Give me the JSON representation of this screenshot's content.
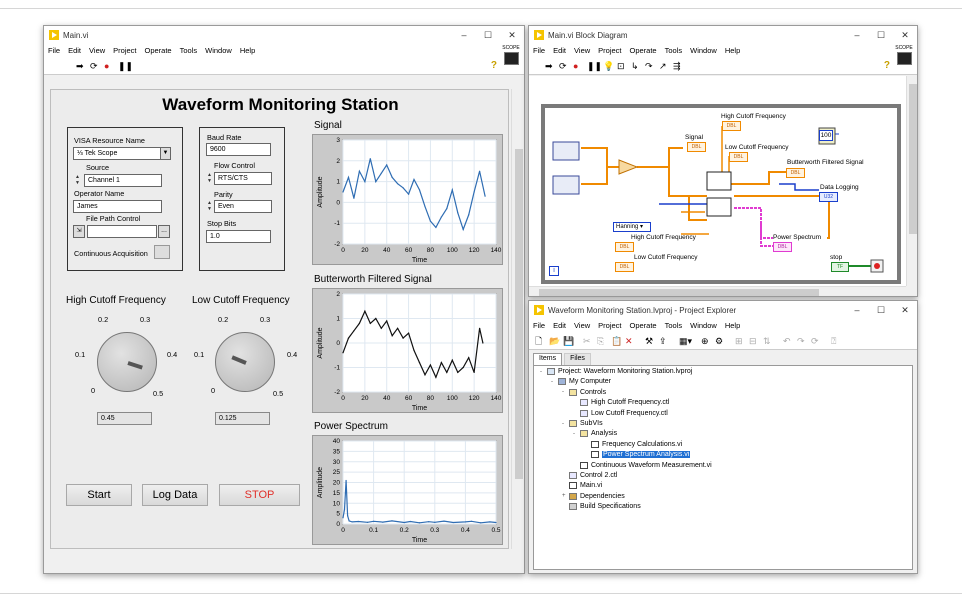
{
  "main_window": {
    "title": "Main.vi",
    "menu": [
      "File",
      "Edit",
      "View",
      "Project",
      "Operate",
      "Tools",
      "Window",
      "Help"
    ],
    "window_controls": [
      "–",
      "☐",
      "✕"
    ],
    "scope_label": "SCOPE",
    "heading": "Waveform Monitoring Station",
    "visa": {
      "resource_label": "VISA Resource Name",
      "resource_value": "Tek Scope",
      "source_label": "Source",
      "source_value": "Channel 1",
      "operator_label": "Operator Name",
      "operator_value": "James",
      "file_path_label": "File Path Control",
      "file_path_value": "",
      "browse_label": "...",
      "continuous_label": "Continuous Acquisition"
    },
    "serial": {
      "baud_label": "Baud Rate",
      "baud_value": "9600",
      "flow_label": "Flow Control",
      "flow_value": "RTS/CTS",
      "parity_label": "Parity",
      "parity_value": "Even",
      "stop_label": "Stop Bits",
      "stop_value": "1.0"
    },
    "knobs": [
      {
        "label": "High Cutoff Frequency",
        "value": "0.45",
        "level": 0.45,
        "scale": [
          "0.2",
          "0.3",
          "0.1",
          "0.4",
          "0",
          "0.5"
        ]
      },
      {
        "label": "Low Cutoff Frequency",
        "value": "0.125",
        "level": 0.125,
        "scale": [
          "0.2",
          "0.3",
          "0.1",
          "0.4",
          "0",
          "0.5"
        ]
      }
    ],
    "buttons": {
      "start": "Start",
      "log": "Log Data",
      "stop": "STOP",
      "stop_color": "#e0302a"
    }
  },
  "charts_meta": {
    "line_color": "#2f6db3",
    "filtered_color": "#111111"
  },
  "chart_data": [
    {
      "type": "line",
      "title": "Signal",
      "xlabel": "Time",
      "ylabel": "Amplitude",
      "xlim": [
        0,
        140
      ],
      "ylim": [
        -2,
        3
      ],
      "xticks": [
        "0",
        "20",
        "40",
        "60",
        "80",
        "100",
        "120",
        "140"
      ],
      "yticks": [
        "3",
        "2",
        "1",
        "0",
        "-1",
        "-2"
      ],
      "x": [
        0,
        5,
        10,
        15,
        20,
        25,
        30,
        35,
        40,
        45,
        50,
        55,
        60,
        65,
        70,
        75,
        80,
        85,
        90,
        95,
        100,
        105,
        110,
        115,
        120,
        125,
        130
      ],
      "values": [
        0.5,
        1.2,
        0.2,
        1.5,
        1.0,
        2.1,
        1.0,
        1.4,
        1.8,
        1.2,
        0.9,
        0.7,
        0.4,
        1.1,
        0.6,
        -0.2,
        -0.9,
        -1.2,
        -0.7,
        -0.3,
        0.6,
        -0.5,
        -1.3,
        -0.6,
        0.5,
        1.5,
        0.3
      ]
    },
    {
      "type": "line",
      "title": "Butterworth Filtered Signal",
      "xlabel": "Time",
      "ylabel": "Amplitude",
      "xlim": [
        0,
        140
      ],
      "ylim": [
        -2,
        2
      ],
      "xticks": [
        "0",
        "20",
        "40",
        "60",
        "80",
        "100",
        "120",
        "140"
      ],
      "yticks": [
        "2",
        "1",
        "0",
        "-1",
        "-2"
      ],
      "x": [
        0,
        5,
        10,
        15,
        20,
        25,
        30,
        35,
        40,
        45,
        50,
        55,
        60,
        65,
        70,
        75,
        80,
        85,
        90,
        95,
        100,
        105,
        110,
        115,
        120,
        125,
        128
      ],
      "values": [
        -0.4,
        0.2,
        0.5,
        0.8,
        1.3,
        0.8,
        1.0,
        0.6,
        0.9,
        0.3,
        0.6,
        0.2,
        0.4,
        -0.3,
        -0.8,
        -1.3,
        -0.9,
        -1.4,
        -0.8,
        -1.2,
        -0.7,
        -1.2,
        -1.0,
        -0.6,
        -1.2,
        0.6,
        0.0
      ]
    },
    {
      "type": "line",
      "title": "Power Spectrum",
      "xlabel": "Time",
      "ylabel": "Amplitude",
      "xlim": [
        0,
        0.5
      ],
      "ylim": [
        0,
        40
      ],
      "xticks": [
        "0",
        "0.1",
        "0.2",
        "0.3",
        "0.4",
        "0.5"
      ],
      "yticks": [
        "40",
        "35",
        "30",
        "25",
        "20",
        "15",
        "10",
        "5",
        "0"
      ],
      "x": [
        0,
        0.005,
        0.01,
        0.015,
        0.02,
        0.03,
        0.05,
        0.08,
        0.1,
        0.13,
        0.16,
        0.2,
        0.22,
        0.25,
        0.28,
        0.3,
        0.33,
        0.36,
        0.4,
        0.42,
        0.45,
        0.48,
        0.5
      ],
      "values": [
        3,
        7,
        21,
        4,
        1.5,
        1,
        1.2,
        0.8,
        1.3,
        0.9,
        1.5,
        0.7,
        1.2,
        0.6,
        1.1,
        0.8,
        1.4,
        0.7,
        1.0,
        1.3,
        0.6,
        1.0,
        0.7
      ]
    }
  ],
  "block_diagram": {
    "title": "Main.vi Block Diagram",
    "menu": [
      "File",
      "Edit",
      "View",
      "Project",
      "Operate",
      "Tools",
      "Window",
      "Help"
    ],
    "window_controls": [
      "–",
      "☐",
      "✕"
    ],
    "scope_label": "SCOPE",
    "labels": {
      "signal": "Signal",
      "high": "High Cutoff Frequency",
      "low": "Low Cutoff Frequency",
      "butter": "Butterworth Filtered Signal",
      "logging": "Data Logging",
      "power": "Power Spectrum",
      "stop": "stop",
      "window_fn": "Hanning",
      "high2": "High Cutoff Frequency",
      "low2": "Low Cutoff Frequency",
      "const100": "100",
      "info": "i",
      "dbl": "DBL",
      "u32": "U32",
      "tf": "TF"
    }
  },
  "project_explorer": {
    "title": "Waveform Monitoring Station.lvproj - Project Explorer",
    "menu": [
      "File",
      "Edit",
      "View",
      "Project",
      "Operate",
      "Tools",
      "Window",
      "Help"
    ],
    "window_controls": [
      "–",
      "☐",
      "✕"
    ],
    "tabs": [
      "Items",
      "Files"
    ],
    "tree": [
      {
        "label": "Project: Waveform Monitoring Station.lvproj",
        "depth": 0,
        "icon": "pj",
        "twisty": "-"
      },
      {
        "label": "My Computer",
        "depth": 1,
        "icon": "pc",
        "twisty": "-"
      },
      {
        "label": "Controls",
        "depth": 2,
        "icon": "folder",
        "twisty": "-"
      },
      {
        "label": "High Cutoff Frequency.ctl",
        "depth": 3,
        "icon": "ctl",
        "twisty": ""
      },
      {
        "label": "Low Cutoff Frequency.ctl",
        "depth": 3,
        "icon": "ctl",
        "twisty": ""
      },
      {
        "label": "SubVIs",
        "depth": 2,
        "icon": "folder",
        "twisty": "-"
      },
      {
        "label": "Analysis",
        "depth": 3,
        "icon": "folder",
        "twisty": "-"
      },
      {
        "label": "Frequency Calculations.vi",
        "depth": 4,
        "icon": "vi",
        "twisty": ""
      },
      {
        "label": "Power Spectrum Analysis.vi",
        "depth": 4,
        "icon": "vi",
        "twisty": "",
        "selected": true
      },
      {
        "label": "Continuous Waveform Measurement.vi",
        "depth": 3,
        "icon": "vi",
        "twisty": ""
      },
      {
        "label": "Control 2.ctl",
        "depth": 2,
        "icon": "ctl",
        "twisty": ""
      },
      {
        "label": "Main.vi",
        "depth": 2,
        "icon": "vi",
        "twisty": ""
      },
      {
        "label": "Dependencies",
        "depth": 2,
        "icon": "dep",
        "twisty": "+"
      },
      {
        "label": "Build Specifications",
        "depth": 2,
        "icon": "bs",
        "twisty": ""
      }
    ]
  }
}
